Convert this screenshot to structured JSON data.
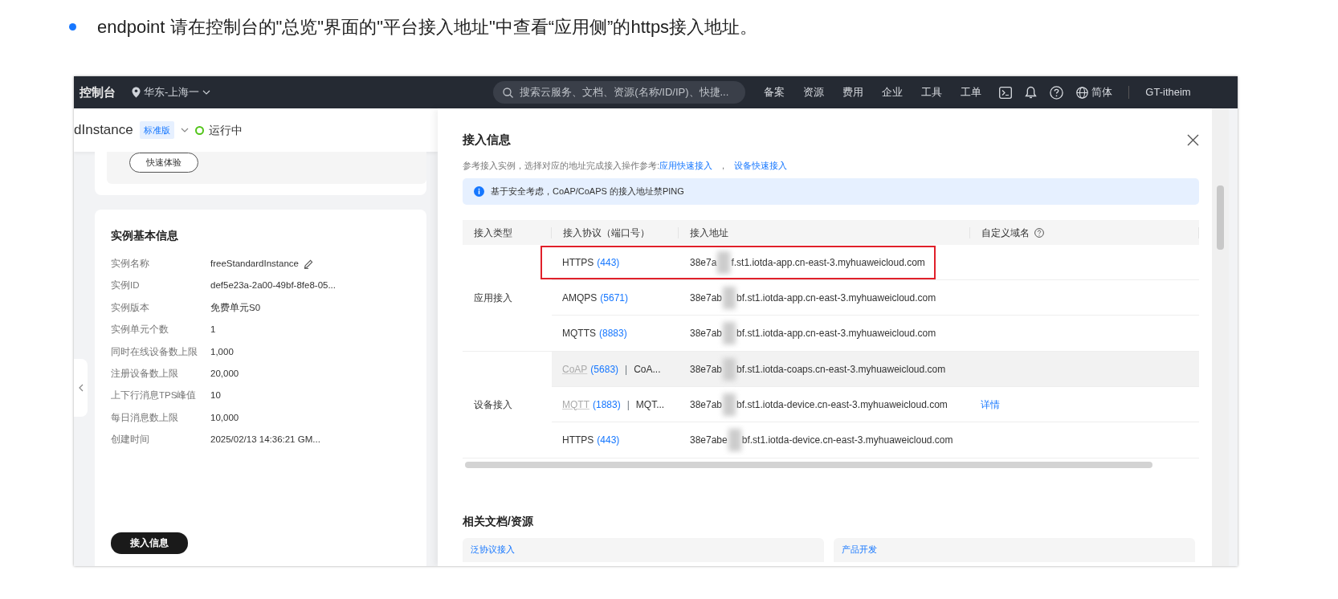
{
  "doc_line": {
    "text": "endpoint 请在控制台的\"总览\"界面的\"平台接入地址\"中查看“应用侧”的https接入地址。"
  },
  "topbar": {
    "brand": "控制台",
    "region": "华东-上海一",
    "search": {
      "placeholder": "搜索云服务、文档、资源(名称/ID/IP)、快捷..."
    },
    "menu": [
      "备案",
      "资源",
      "费用",
      "企业",
      "工具",
      "工单"
    ],
    "language": "简体",
    "user": "GT-itheim"
  },
  "instance_header": {
    "name": "dInstance",
    "edition": "标准版",
    "status": "运行中"
  },
  "quick_button": "快速体验",
  "basic_info": {
    "title": "实例基本信息",
    "fields": [
      {
        "label": "实例名称",
        "value": "freeStandardInstance",
        "editable": true
      },
      {
        "label": "实例ID",
        "value": "def5e23a-2a00-49bf-8fe8-05...",
        "editable": false
      },
      {
        "label": "实例版本",
        "value": "免费单元S0",
        "editable": false
      },
      {
        "label": "实例单元个数",
        "value": "1",
        "editable": false
      },
      {
        "label": "同时在线设备数上限",
        "value": "1,000",
        "editable": false
      },
      {
        "label": "注册设备数上限",
        "value": "20,000",
        "editable": false
      },
      {
        "label": "上下行消息TPS峰值",
        "value": "10",
        "editable": false
      },
      {
        "label": "每日消息数上限",
        "value": "10,000",
        "editable": false
      },
      {
        "label": "创建时间",
        "value": "2025/02/13 14:36:21 GM...",
        "editable": false
      }
    ],
    "access_button": "接入信息"
  },
  "drawer": {
    "title": "接入信息",
    "intro": "参考接入实例，选择对应的地址完成接入操作参考:",
    "links": [
      "应用快速接入",
      "设备快速接入"
    ],
    "link_separator": "，",
    "notice": "基于安全考虑，CoAP/CoAPS 的接入地址禁PING",
    "columns": [
      "接入类型",
      "接入协议（端口号）",
      "接入地址",
      "自定义域名"
    ],
    "groups": [
      {
        "type": "应用接入",
        "rows": [
          {
            "protocols": [
              {
                "name": "HTTPS",
                "port": "(443)",
                "dimmed": false
              }
            ],
            "address_start": "38e7a",
            "address_end": "f.st1.iotda-app.cn-east-3.myhuaweicloud.com",
            "highlighted": true,
            "shaded": false
          },
          {
            "protocols": [
              {
                "name": "AMQPS",
                "port": "(5671)",
                "dimmed": false
              }
            ],
            "address_start": "38e7ab",
            "address_end": "bf.st1.iotda-app.cn-east-3.myhuaweicloud.com",
            "highlighted": false,
            "shaded": false
          },
          {
            "protocols": [
              {
                "name": "MQTTS",
                "port": "(8883)",
                "dimmed": false
              }
            ],
            "address_start": "38e7ab",
            "address_end": "bf.st1.iotda-app.cn-east-3.myhuaweicloud.com",
            "highlighted": false,
            "shaded": false
          }
        ]
      },
      {
        "type": "设备接入",
        "rows": [
          {
            "protocols": [
              {
                "name": "CoAP",
                "port": "(5683)",
                "dimmed": true
              },
              {
                "name": "CoA...",
                "dimmed": false
              }
            ],
            "separator": "|",
            "address_start": "38e7ab",
            "address_end": "bf.st1.iotda-coaps.cn-east-3.myhuaweicloud.com",
            "highlighted": false,
            "shaded": true
          },
          {
            "protocols": [
              {
                "name": "MQTT",
                "port": "(1883)",
                "dimmed": true
              },
              {
                "name": "MQT...",
                "dimmed": false
              }
            ],
            "separator": "|",
            "address_start": "38e7ab",
            "address_end": "bf.st1.iotda-device.cn-east-3.myhuaweicloud.com",
            "custom_domain_link": "详情",
            "highlighted": false,
            "shaded": false
          },
          {
            "protocols": [
              {
                "name": "HTTPS",
                "port": "(443)",
                "dimmed": false
              }
            ],
            "address_start": "38e7abe",
            "address_end": "bf.st1.iotda-device.cn-east-3.myhuaweicloud.com",
            "highlighted": false,
            "shaded": false
          }
        ]
      }
    ]
  },
  "related": {
    "title": "相关文档/资源",
    "cards": [
      "泛协议接入",
      "产品开发"
    ]
  }
}
